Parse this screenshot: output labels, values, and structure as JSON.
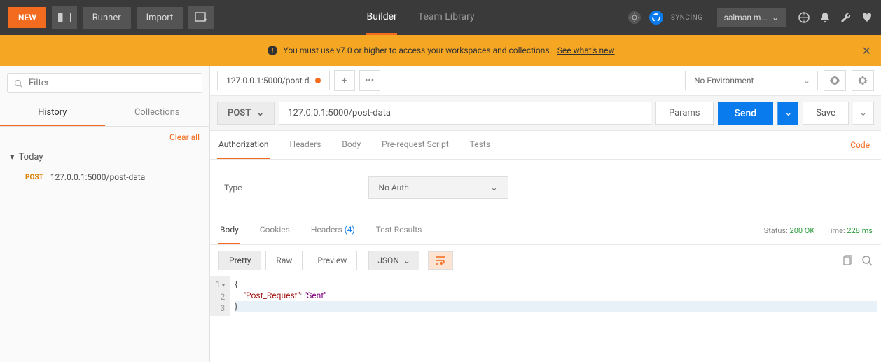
{
  "topbar": {
    "new_label": "NEW",
    "runner_label": "Runner",
    "import_label": "Import",
    "tabs": {
      "builder": "Builder",
      "team": "Team Library"
    },
    "sync_label": "SYNCING",
    "user_label": "salman m..."
  },
  "notice": {
    "text": "You must use v7.0 or higher to access your workspaces and collections.",
    "link": "See what's new"
  },
  "sidebar": {
    "filter_placeholder": "Filter",
    "tabs": {
      "history": "History",
      "collections": "Collections"
    },
    "clear_all": "Clear all",
    "group_label": "Today",
    "item_method": "POST",
    "item_url": "127.0.0.1:5000/post-data"
  },
  "reqtab": {
    "label": "127.0.0.1:5000/post-d"
  },
  "env": {
    "none": "No Environment"
  },
  "request": {
    "method": "POST",
    "url": "127.0.0.1:5000/post-data",
    "params": "Params",
    "send": "Send",
    "save": "Save"
  },
  "subtabs": {
    "auth": "Authorization",
    "headers": "Headers",
    "body": "Body",
    "prereq": "Pre-request Script",
    "tests": "Tests",
    "code": "Code"
  },
  "auth": {
    "type_label": "Type",
    "selected": "No Auth"
  },
  "response_tabs": {
    "body": "Body",
    "cookies": "Cookies",
    "headers": "Headers",
    "headers_count": "(4)",
    "tests": "Test Results"
  },
  "status": {
    "status_label": "Status:",
    "status_value": "200 OK",
    "time_label": "Time:",
    "time_value": "228 ms"
  },
  "views": {
    "pretty": "Pretty",
    "raw": "Raw",
    "preview": "Preview",
    "json": "JSON"
  },
  "response_body": {
    "line1": "{",
    "line2_key": "\"Post_Request\"",
    "line2_sep": ": ",
    "line2_val": "\"Sent\"",
    "line3": "}"
  }
}
